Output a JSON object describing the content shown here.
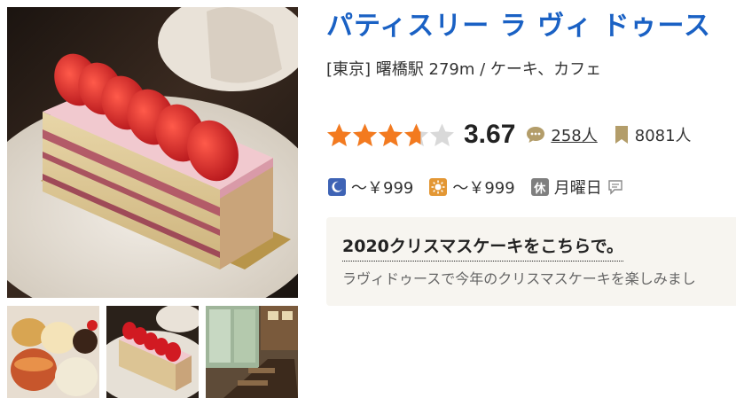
{
  "shop": {
    "name": "パティスリー ラ ヴィ ドゥース",
    "area_line": "[東京] 曙橋駅 279m / ケーキ、カフェ"
  },
  "rating": {
    "score": "3.67",
    "stars_value": 3.67,
    "stars_max": 5,
    "review_count": "258人",
    "bookmark_count": "8081人",
    "star_color": "#f37a1f",
    "star_empty_color": "#d9d9d9"
  },
  "budget": {
    "dinner": "～￥999",
    "lunch": "～￥999",
    "holiday_badge": "休",
    "holiday": "月曜日"
  },
  "pr": {
    "title": "2020クリスマスケーキをこちらで。",
    "text": "ラヴィドゥースで今年のクリスマスケーキを楽しみまし"
  },
  "colors": {
    "title_blue": "#1a61c4",
    "dinner_icon": "#3e63b5",
    "lunch_icon": "#e39734",
    "holiday_icon": "#7f7f7f",
    "bookmark_icon": "#b39d6a",
    "pr_background": "#f7f5f0"
  },
  "icons": [
    "moon-icon",
    "sun-icon",
    "comment-icon",
    "bookmark-icon",
    "speech-bubble-icon",
    "star-icon"
  ]
}
